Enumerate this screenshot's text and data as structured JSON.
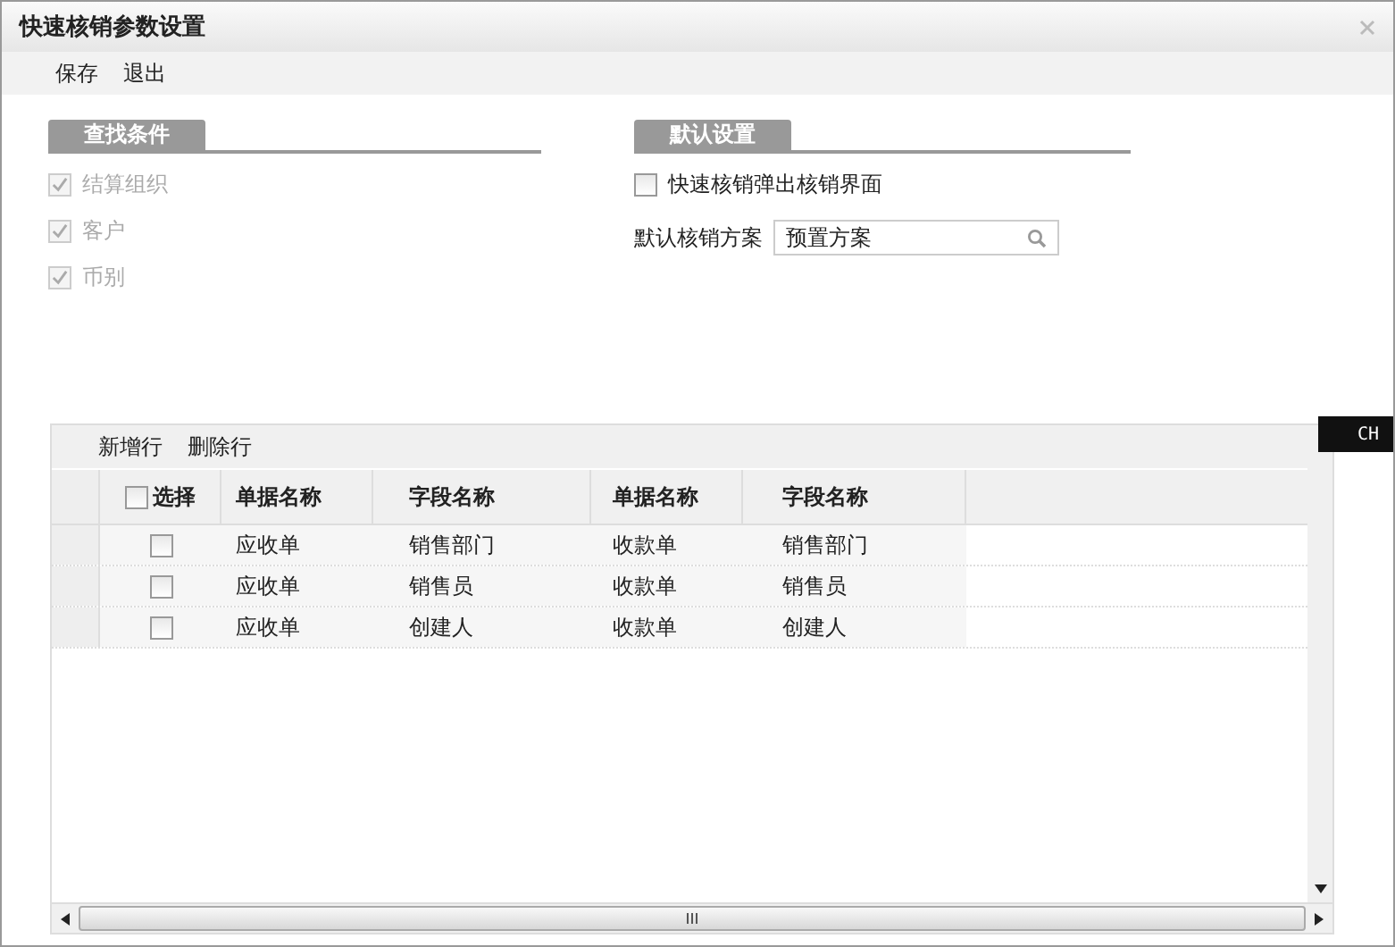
{
  "window": {
    "title": "快速核销参数设置"
  },
  "toolbar": [
    "保存",
    "退出"
  ],
  "search_conditions": {
    "title": "查找条件",
    "items": [
      {
        "label": "结算组织",
        "checked": true,
        "disabled": true
      },
      {
        "label": "客户",
        "checked": true,
        "disabled": true
      },
      {
        "label": "币别",
        "checked": true,
        "disabled": true
      }
    ]
  },
  "default_settings": {
    "title": "默认设置",
    "popup": {
      "label": "快速核销弹出核销界面",
      "checked": false
    },
    "scheme": {
      "label": "默认核销方案",
      "value": "预置方案"
    }
  },
  "grid_toolbar": [
    "新增行",
    "删除行"
  ],
  "table": {
    "select_all": {
      "label": "选择",
      "checked": false
    },
    "columns": [
      "单据名称",
      "字段名称",
      "单据名称",
      "字段名称"
    ],
    "rows": [
      {
        "checked": false,
        "cells": [
          "应收单",
          "销售部门",
          "收款单",
          "销售部门"
        ]
      },
      {
        "checked": false,
        "cells": [
          "应收单",
          "销售员",
          "收款单",
          "销售员"
        ]
      },
      {
        "checked": false,
        "cells": [
          "应收单",
          "创建人",
          "收款单",
          "创建人"
        ]
      }
    ]
  },
  "ime_indicator": "CH"
}
